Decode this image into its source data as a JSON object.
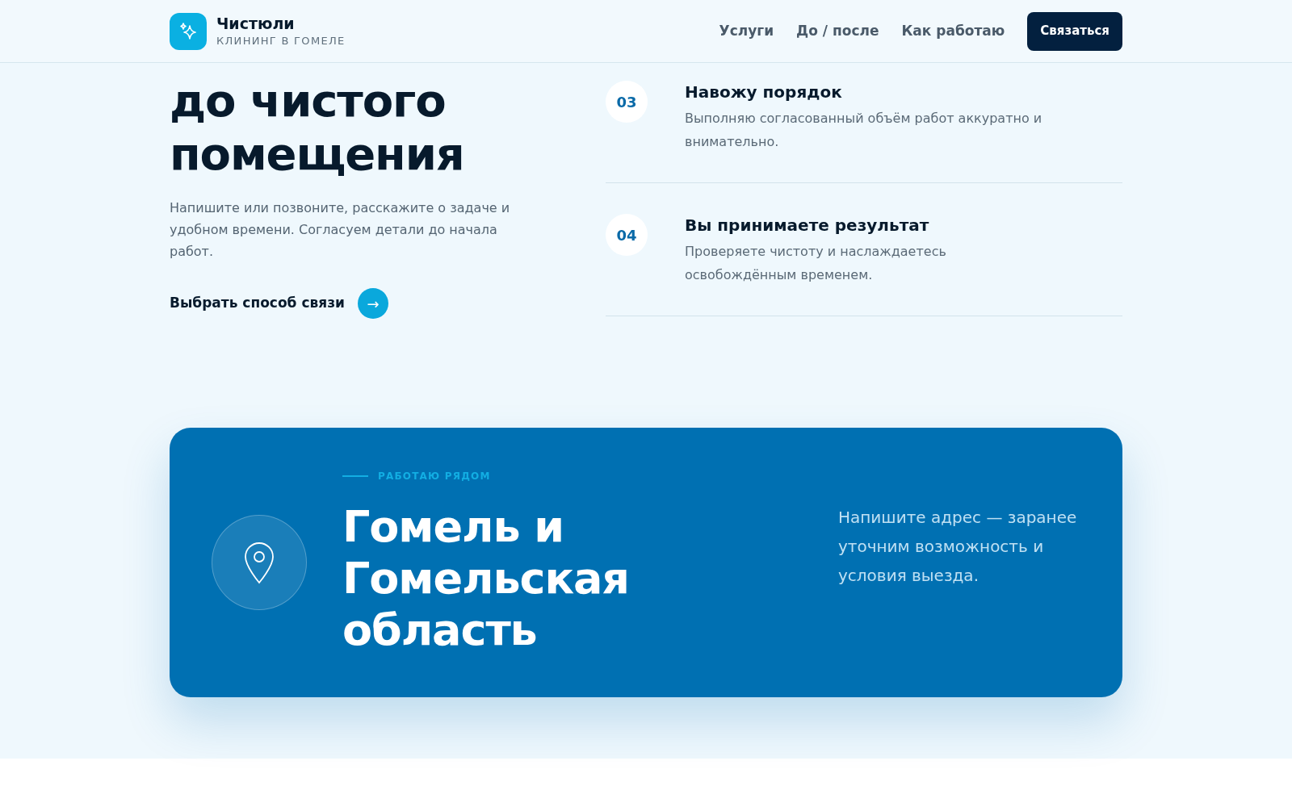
{
  "header": {
    "brand": {
      "name": "Чистюли",
      "tagline": "КЛИНИНГ В ГОМЕЛЕ"
    },
    "nav": [
      {
        "label": "Услуги"
      },
      {
        "label": "До / после"
      },
      {
        "label": "Как работаю"
      }
    ],
    "cta": "Связаться"
  },
  "intro": {
    "heading_lines": [
      "до чистого",
      "помещения"
    ],
    "text": "Напишите или позвоните, расскажите о задаче и удобном времени. Согласуем детали до начала работ.",
    "link": "Выбрать способ связи",
    "link_icon": "→"
  },
  "steps": [
    {
      "number": "03",
      "title": "Навожу порядок",
      "text": "Выполняю согласованный объём работ аккуратно и внимательно."
    },
    {
      "number": "04",
      "title": "Вы принимаете результат",
      "text": "Проверяете чистоту и наслаждаетесь освобождённым временем."
    }
  ],
  "area": {
    "eyebrow": "РАБОТАЮ РЯДОМ",
    "title_lines": [
      "Гомель и",
      "Гомельская",
      "область"
    ],
    "text": "Напишите адрес — заранее уточним возможность и условия выезда."
  }
}
